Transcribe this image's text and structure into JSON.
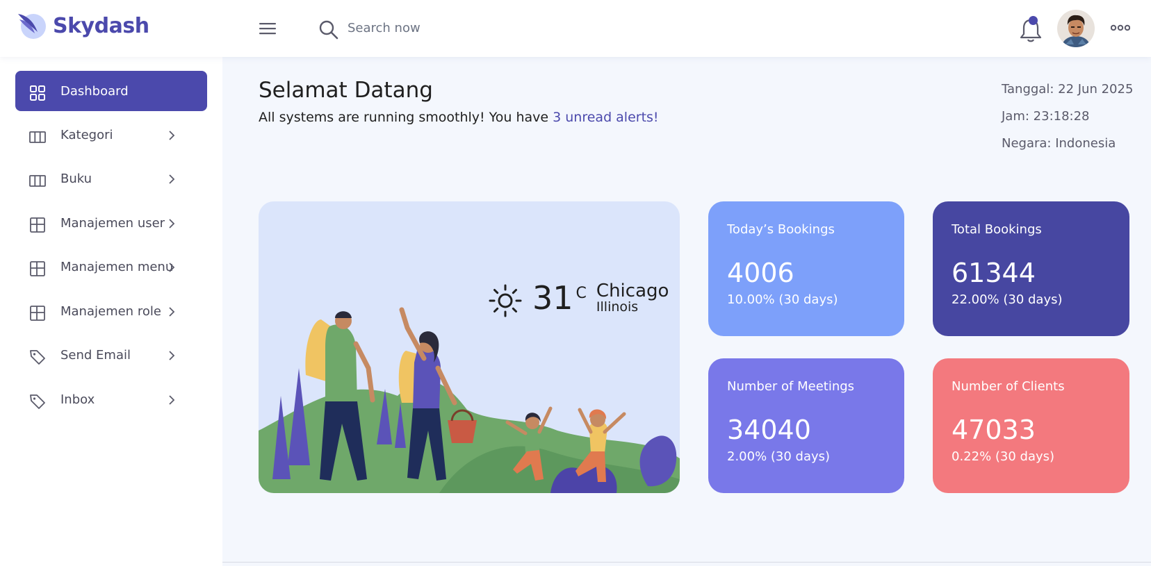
{
  "brand": {
    "name": "Skydash"
  },
  "search": {
    "placeholder": "Search now"
  },
  "sidebar": {
    "items": [
      {
        "label": "Dashboard",
        "icon": "grid-icon"
      },
      {
        "label": "Kategori",
        "icon": "columns-icon"
      },
      {
        "label": "Buku",
        "icon": "columns-icon"
      },
      {
        "label": "Manajemen user",
        "icon": "layout-icon"
      },
      {
        "label": "Manajemen menu",
        "icon": "layout-icon"
      },
      {
        "label": "Manajemen role",
        "icon": "layout-icon"
      },
      {
        "label": "Send Email",
        "icon": "tag-icon"
      },
      {
        "label": "Inbox",
        "icon": "tag-icon"
      }
    ]
  },
  "main": {
    "title": "Selamat Datang",
    "subtitle_prefix": "All systems are running smoothly! You have ",
    "alerts_link": "3 unread alerts!",
    "date": "Tanggal: 22 Jun 2025",
    "time": "Jam: 23:18:28",
    "country": "Negara: Indonesia"
  },
  "weather": {
    "temperature": "31",
    "unit": "C",
    "city": "Chicago",
    "state": "Illinois",
    "icon": "sun-icon"
  },
  "stats": [
    {
      "label": "Today’s Bookings",
      "value": "4006",
      "change": "10.00% (30 days)",
      "color": "#7da0fa"
    },
    {
      "label": "Total Bookings",
      "value": "61344",
      "change": "22.00% (30 days)",
      "color": "#4747a1"
    },
    {
      "label": "Number of Meetings",
      "value": "34040",
      "change": "2.00% (30 days)",
      "color": "#7978e9"
    },
    {
      "label": "Number of Clients",
      "value": "47033",
      "change": "0.22% (30 days)",
      "color": "#f3797e"
    }
  ],
  "colors": {
    "accent": "#4b49ac",
    "background": "#f4f7fd",
    "weather_card": "#dbe5fb"
  }
}
